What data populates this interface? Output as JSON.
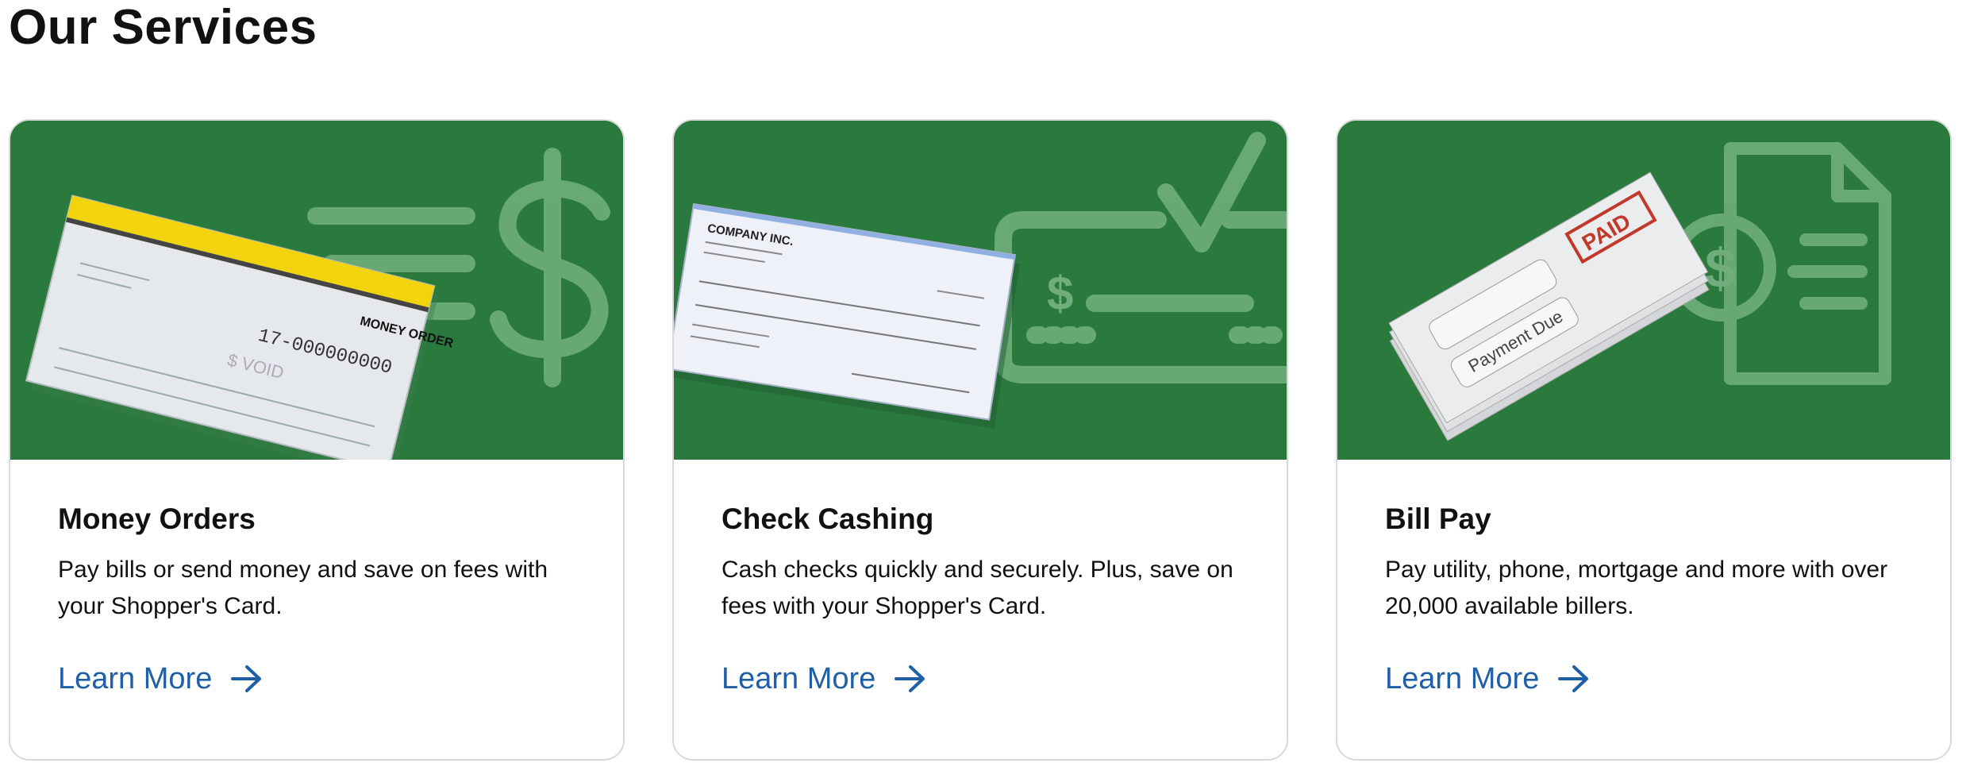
{
  "section": {
    "title": "Our Services"
  },
  "colors": {
    "card_banner": "#2a7a3e",
    "link": "#1f5fa8",
    "card_border": "#d9d9d9"
  },
  "cards": [
    {
      "title": "Money Orders",
      "description": "Pay bills or send money and save on fees with your Shopper's Card.",
      "link_label": "Learn More",
      "image": {
        "icon": "dollar-sign-icon",
        "money_order_label": "MONEY ORDER",
        "number": "17-000000000",
        "void_text": "$ VOID"
      }
    },
    {
      "title": "Check Cashing",
      "description": "Cash checks quickly and securely. Plus, save on fees with your Shopper's Card.",
      "link_label": "Learn More",
      "image": {
        "icon": "check-mark-icon",
        "company": "COMPANY INC."
      }
    },
    {
      "title": "Bill Pay",
      "description": "Pay utility, phone, mortgage and more with over 20,000 available billers.",
      "link_label": "Learn More",
      "image": {
        "icon": "document-dollar-icon",
        "stamp": "PAID",
        "envelope_text": "Payment Due"
      }
    }
  ]
}
